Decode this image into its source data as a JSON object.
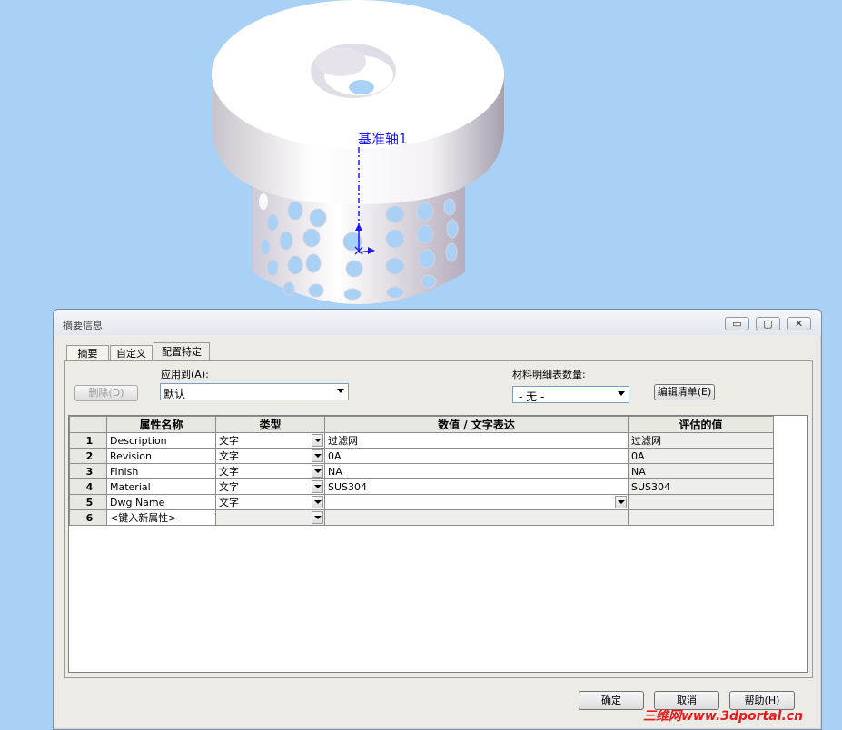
{
  "viewport": {
    "axis_label": "基准轴1"
  },
  "dialog": {
    "title": "摘要信息",
    "window_buttons": [
      "▭",
      "▢",
      "✕"
    ],
    "tabs": [
      {
        "label": "摘要",
        "active": false
      },
      {
        "label": "自定义",
        "active": false
      },
      {
        "label": "配置特定",
        "active": true
      }
    ],
    "apply_to_label": "应用到(A):",
    "apply_to_value": "默认",
    "bom_qty_label": "材料明细表数量:",
    "bom_qty_value": "- 无 -",
    "delete_button": "删除(D)",
    "edit_list_button": "编辑清单(E)",
    "grid": {
      "headers": [
        "",
        "属性名称",
        "类型",
        "数值 / 文字表达",
        "评估的值"
      ],
      "rows": [
        {
          "num": "1",
          "name": "Description",
          "type": "文字",
          "value": "过滤网",
          "evaluated": "过滤网"
        },
        {
          "num": "2",
          "name": "Revision",
          "type": "文字",
          "value": "0A",
          "evaluated": "0A"
        },
        {
          "num": "3",
          "name": "Finish",
          "type": "文字",
          "value": "NA",
          "evaluated": "NA"
        },
        {
          "num": "4",
          "name": "Material",
          "type": "文字",
          "value": "SUS304",
          "evaluated": "SUS304"
        },
        {
          "num": "5",
          "name": "Dwg Name",
          "type": "文字",
          "value": "",
          "evaluated": ""
        },
        {
          "num": "6",
          "name": "<键入新属性>",
          "type": "",
          "value": "",
          "evaluated": ""
        }
      ]
    },
    "ok_button": "确定",
    "cancel_button": "取消",
    "help_button": "帮助(H)"
  },
  "watermark": "三维网www.3dportal.cn"
}
